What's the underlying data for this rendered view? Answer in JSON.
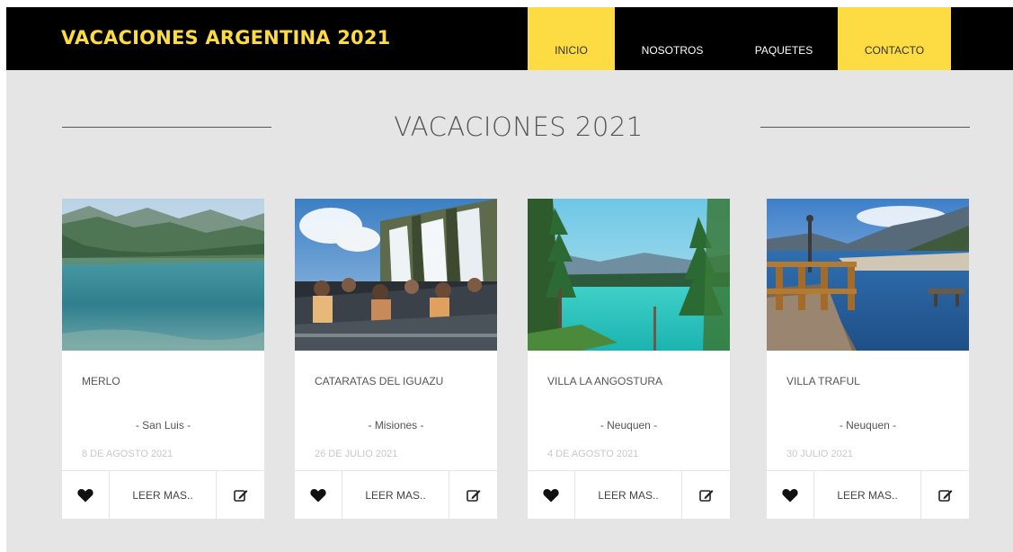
{
  "header": {
    "brand": "VACACIONES ARGENTINA 2021",
    "nav": [
      {
        "label": "INICIO",
        "active": true
      },
      {
        "label": "NOSOTROS",
        "active": false
      },
      {
        "label": "PAQUETES",
        "active": false
      },
      {
        "label": "CONTACTO",
        "active": true
      }
    ]
  },
  "section": {
    "title": "VACACIONES 2021"
  },
  "cards": [
    {
      "name": "MERLO",
      "region": "- San Luis -",
      "date": "8 DE AGOSTO 2021",
      "read_more": "LEER MAS..",
      "icons": [
        "heart-icon",
        "edit-icon"
      ]
    },
    {
      "name": "CATARATAS DEL IGUAZU",
      "region": "- Misiones -",
      "date": "26 DE JULIO 2021",
      "read_more": "LEER MAS..",
      "icons": [
        "heart-icon",
        "edit-icon"
      ]
    },
    {
      "name": "VILLA LA ANGOSTURA",
      "region": "- Neuquen -",
      "date": "4 DE AGOSTO 2021",
      "read_more": "LEER MAS..",
      "icons": [
        "heart-icon",
        "edit-icon"
      ]
    },
    {
      "name": "VILLA TRAFUL",
      "region": "- Neuquen -",
      "date": "30 JULIO 2021",
      "read_more": "LEER MAS..",
      "icons": [
        "heart-icon",
        "edit-icon"
      ]
    }
  ],
  "colors": {
    "accent": "#fcdc42",
    "header_bg": "#000000",
    "page_bg": "#e5e5e5",
    "card_bg": "#ffffff",
    "date_text": "#c8c8c8"
  }
}
